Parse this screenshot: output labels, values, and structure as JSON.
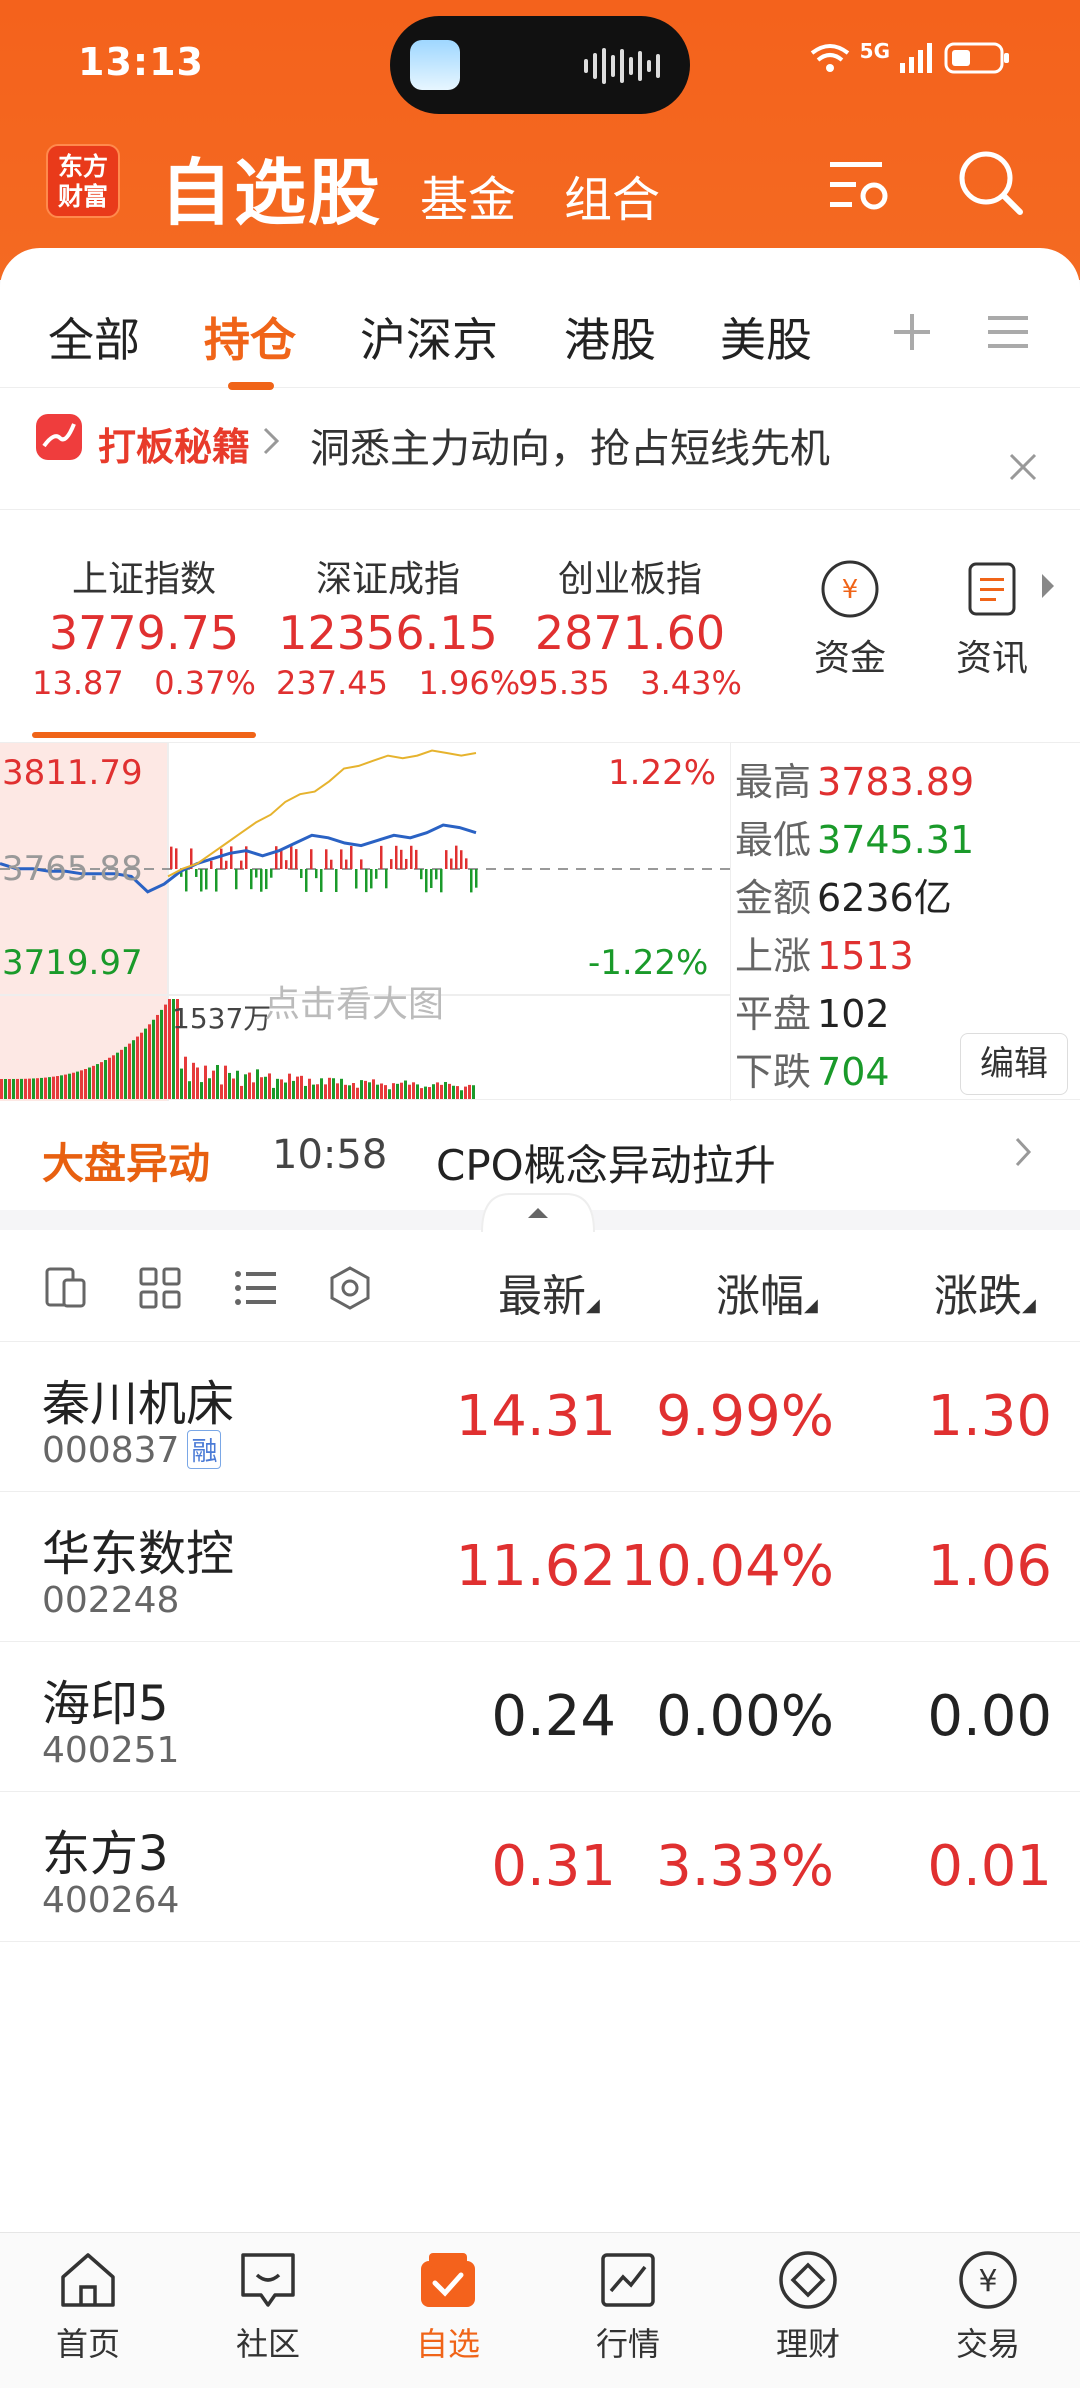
{
  "status": {
    "time": "13:13",
    "network": "5G"
  },
  "app": {
    "logo_line1": "东方",
    "logo_line2": "财富",
    "title": "自选股",
    "tabs": [
      "基金",
      "组合"
    ]
  },
  "watch_tabs": {
    "items": [
      "全部",
      "持仓",
      "沪深京",
      "港股",
      "美股"
    ],
    "active": "持仓"
  },
  "banner": {
    "brand": "打板秘籍",
    "text": "洞悉主力动向，抢占短线先机"
  },
  "indices": [
    {
      "name": "上证指数",
      "value": "3779.75",
      "change": "13.87",
      "pct": "0.37%"
    },
    {
      "name": "深证成指",
      "value": "12356.15",
      "change": "237.45",
      "pct": "1.96%"
    },
    {
      "name": "创业板指",
      "value": "2871.60",
      "change": "95.35",
      "pct": "3.43%"
    }
  ],
  "index_actions": {
    "funds": "资金",
    "news": "资讯"
  },
  "chart": {
    "high": "3811.79",
    "prev_close": "3765.88",
    "low": "3719.97",
    "pct_up": "1.22%",
    "pct_down": "-1.22%",
    "volume_label": "1537万",
    "overlay_hint": "点击看大图"
  },
  "chart_data": {
    "type": "line",
    "title": "",
    "ylim": [
      3719.97,
      3811.79
    ],
    "baseline": 3765.88,
    "series": [
      {
        "values": [
          3768,
          3766,
          3766,
          3765,
          3765,
          3764,
          3764,
          3764,
          3763,
          3757,
          3760,
          3765,
          3768,
          3770,
          3772,
          3773,
          3771,
          3773,
          3776,
          3779,
          3778,
          3776,
          3775,
          3777,
          3779,
          3778,
          3780,
          3783,
          3782,
          3780
        ]
      },
      {
        "values": [
          3763,
          3766,
          3768,
          3772,
          3776,
          3780,
          3784,
          3787,
          3792,
          3795,
          3796,
          3800,
          3805,
          3806,
          3808,
          3810,
          3809,
          3810,
          3812,
          3811,
          3810,
          3811
        ]
      }
    ]
  },
  "stats": [
    {
      "label": "最高",
      "value": "3783.89",
      "color": "red"
    },
    {
      "label": "最低",
      "value": "3745.31",
      "color": "green"
    },
    {
      "label": "金额",
      "value": "6236亿",
      "color": "black"
    },
    {
      "label": "上涨",
      "value": "1513",
      "color": "red"
    },
    {
      "label": "平盘",
      "value": "102",
      "color": "black"
    },
    {
      "label": "下跌",
      "value": "704",
      "color": "green"
    }
  ],
  "edit_label": "编辑",
  "alert": {
    "label": "大盘异动",
    "time": "10:58",
    "message": "CPO概念异动拉升"
  },
  "list_header": {
    "latest": "最新",
    "pct": "涨幅",
    "change": "涨跌"
  },
  "stocks": [
    {
      "name": "秦川机床",
      "code": "000837",
      "tag": "融",
      "price": "14.31",
      "pct": "9.99%",
      "chg": "1.30",
      "color": "red"
    },
    {
      "name": "华东数控",
      "code": "002248",
      "tag": "",
      "price": "11.62",
      "pct": "10.04%",
      "chg": "1.06",
      "color": "red"
    },
    {
      "name": "海印5",
      "code": "400251",
      "tag": "",
      "price": "0.24",
      "pct": "0.00%",
      "chg": "0.00",
      "color": "black"
    },
    {
      "name": "东方3",
      "code": "400264",
      "tag": "",
      "price": "0.31",
      "pct": "3.33%",
      "chg": "0.01",
      "color": "red"
    }
  ],
  "bottom_nav": [
    {
      "label": "首页",
      "icon": "home-icon"
    },
    {
      "label": "社区",
      "icon": "community-icon"
    },
    {
      "label": "自选",
      "icon": "watchlist-icon",
      "active": true
    },
    {
      "label": "行情",
      "icon": "market-icon"
    },
    {
      "label": "理财",
      "icon": "wealth-icon"
    },
    {
      "label": "交易",
      "icon": "trade-icon"
    }
  ],
  "colors": {
    "brand": "#f4621c",
    "up": "#e03030",
    "down": "#1a9a2a"
  }
}
